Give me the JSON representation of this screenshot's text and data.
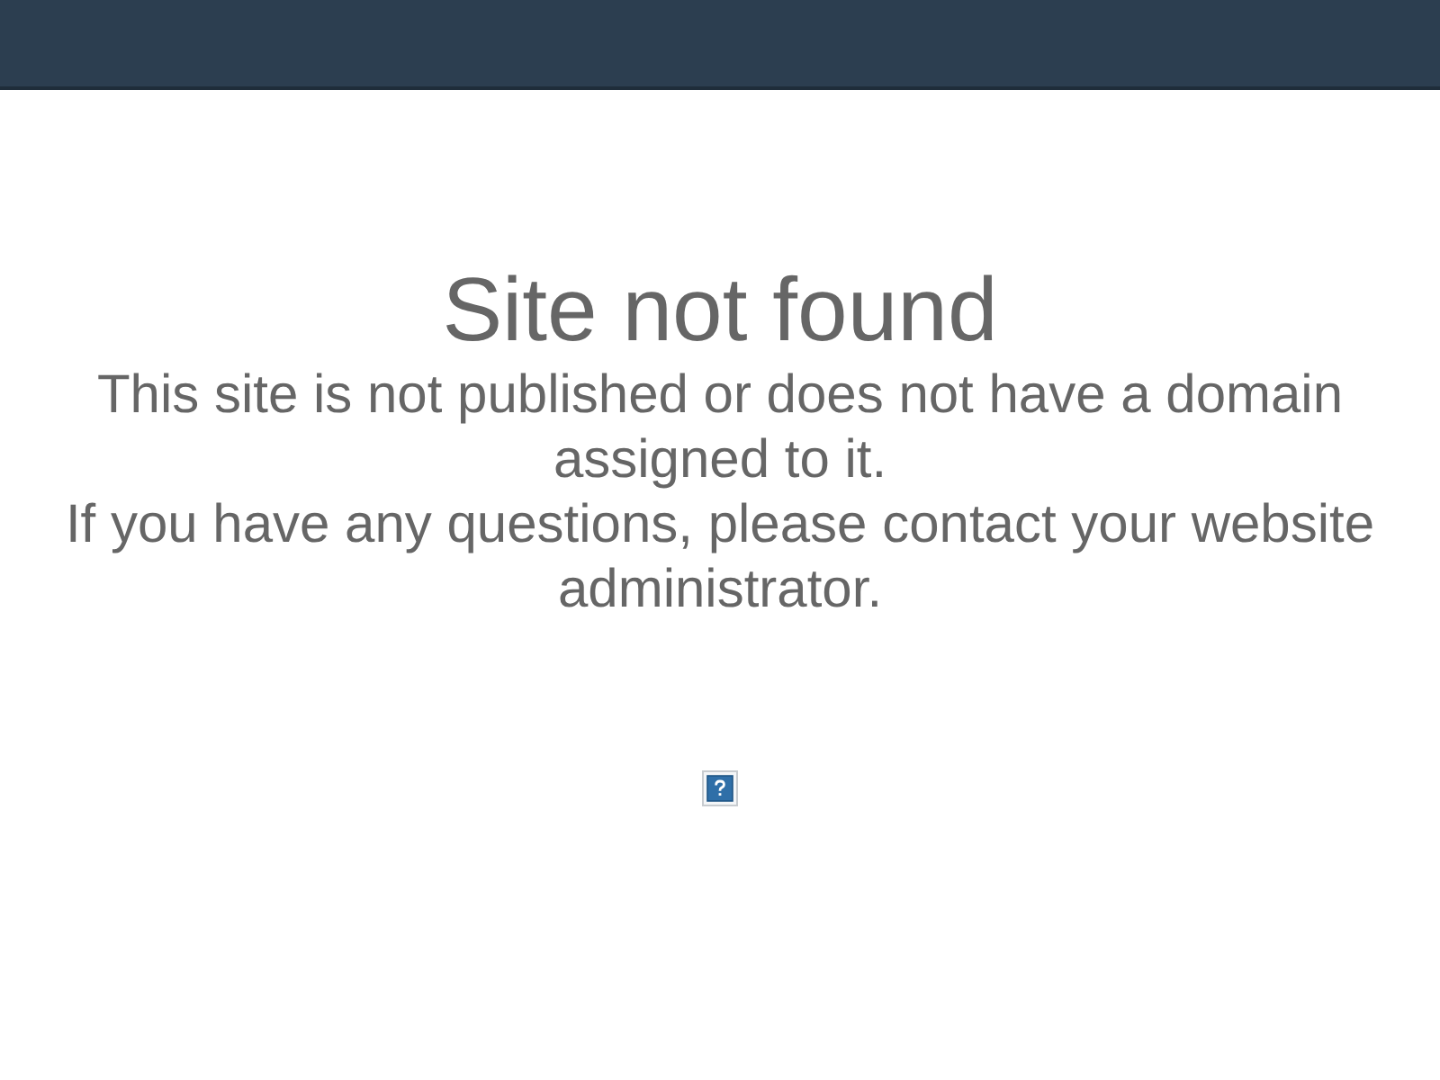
{
  "title": "Site not found",
  "message": [
    "This site is not published or does not have a domain assigned to it.",
    "If you have any questions, please contact your website administrator."
  ]
}
